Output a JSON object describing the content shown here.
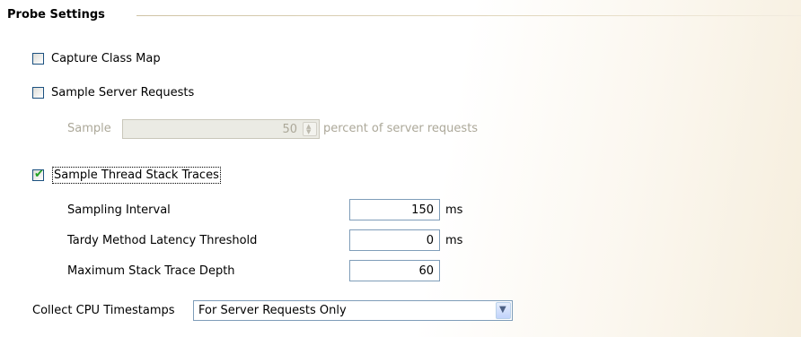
{
  "section": {
    "title": "Probe Settings"
  },
  "capture_class_map": {
    "label": "Capture Class Map",
    "checked": false
  },
  "sample_server_requests": {
    "label": "Sample Server Requests",
    "checked": false
  },
  "sample": {
    "label": "Sample",
    "value": "50",
    "suffix": "percent of server requests"
  },
  "sample_thread_stack_traces": {
    "label": "Sample Thread Stack Traces",
    "checked": true,
    "check_mark": "✔"
  },
  "sampling_interval": {
    "label": "Sampling Interval",
    "value": "150",
    "unit": "ms"
  },
  "tardy_threshold": {
    "label": "Tardy Method Latency Threshold",
    "value": "0",
    "unit": "ms"
  },
  "max_stack_depth": {
    "label": "Maximum Stack Trace Depth",
    "value": "60"
  },
  "collect_cpu": {
    "label": "Collect CPU Timestamps",
    "selected": "For Server Requests Only"
  },
  "colors": {
    "checkbox_border": "#1c5180",
    "check": "#21a121",
    "field_border": "#7f9db9",
    "disabled_text": "#aca899"
  },
  "icons": {
    "spinner": "spinner-arrows-icon",
    "dropdown": "chevron-down-icon"
  }
}
